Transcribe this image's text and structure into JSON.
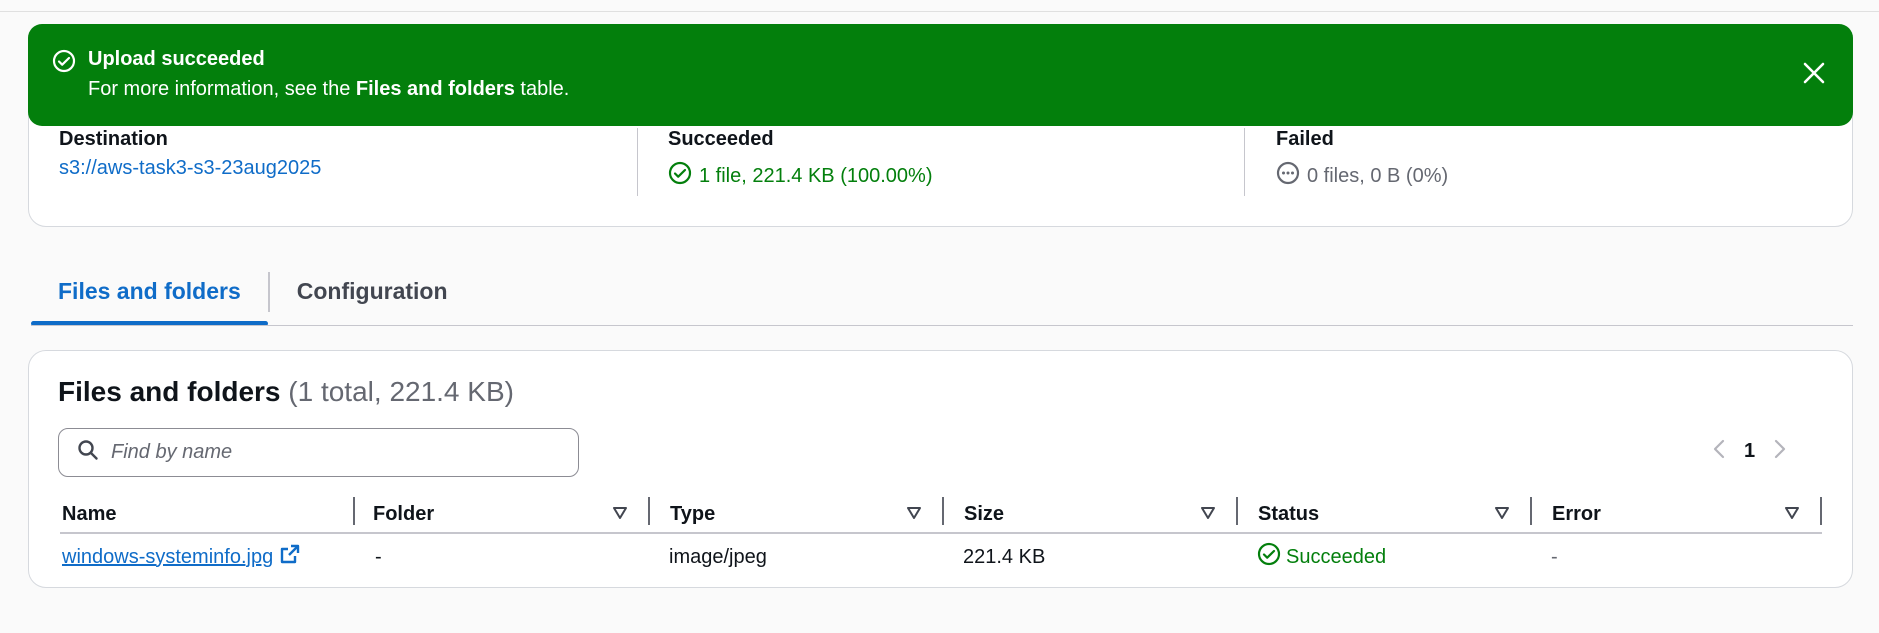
{
  "banner": {
    "title": "Upload succeeded",
    "message_prefix": "For more information, see the ",
    "message_bold": "Files and folders",
    "message_suffix": " table.",
    "close_icon": "close-icon",
    "color": "#037f0c"
  },
  "summary": {
    "destination_label": "Destination",
    "destination_value": "s3://aws-task3-s3-23aug2025",
    "succeeded_label": "Succeeded",
    "succeeded_value": "1 file, 221.4 KB (100.00%)",
    "failed_label": "Failed",
    "failed_value": "0 files, 0 B (0%)"
  },
  "tabs": [
    {
      "label": "Files and folders",
      "active": true
    },
    {
      "label": "Configuration",
      "active": false
    }
  ],
  "files": {
    "title": "Files and folders",
    "count": "(1 total, 221.4 KB)",
    "search_placeholder": "Find by name",
    "page": "1",
    "columns": [
      "Name",
      "Folder",
      "Type",
      "Size",
      "Status",
      "Error"
    ],
    "rows": [
      {
        "name": "windows-systeminfo.jpg",
        "folder": "-",
        "type": "image/jpeg",
        "size": "221.4 KB",
        "status": "Succeeded",
        "error": "-"
      }
    ]
  },
  "colors": {
    "accent": "#0f6cc8",
    "success": "#037f0c"
  }
}
